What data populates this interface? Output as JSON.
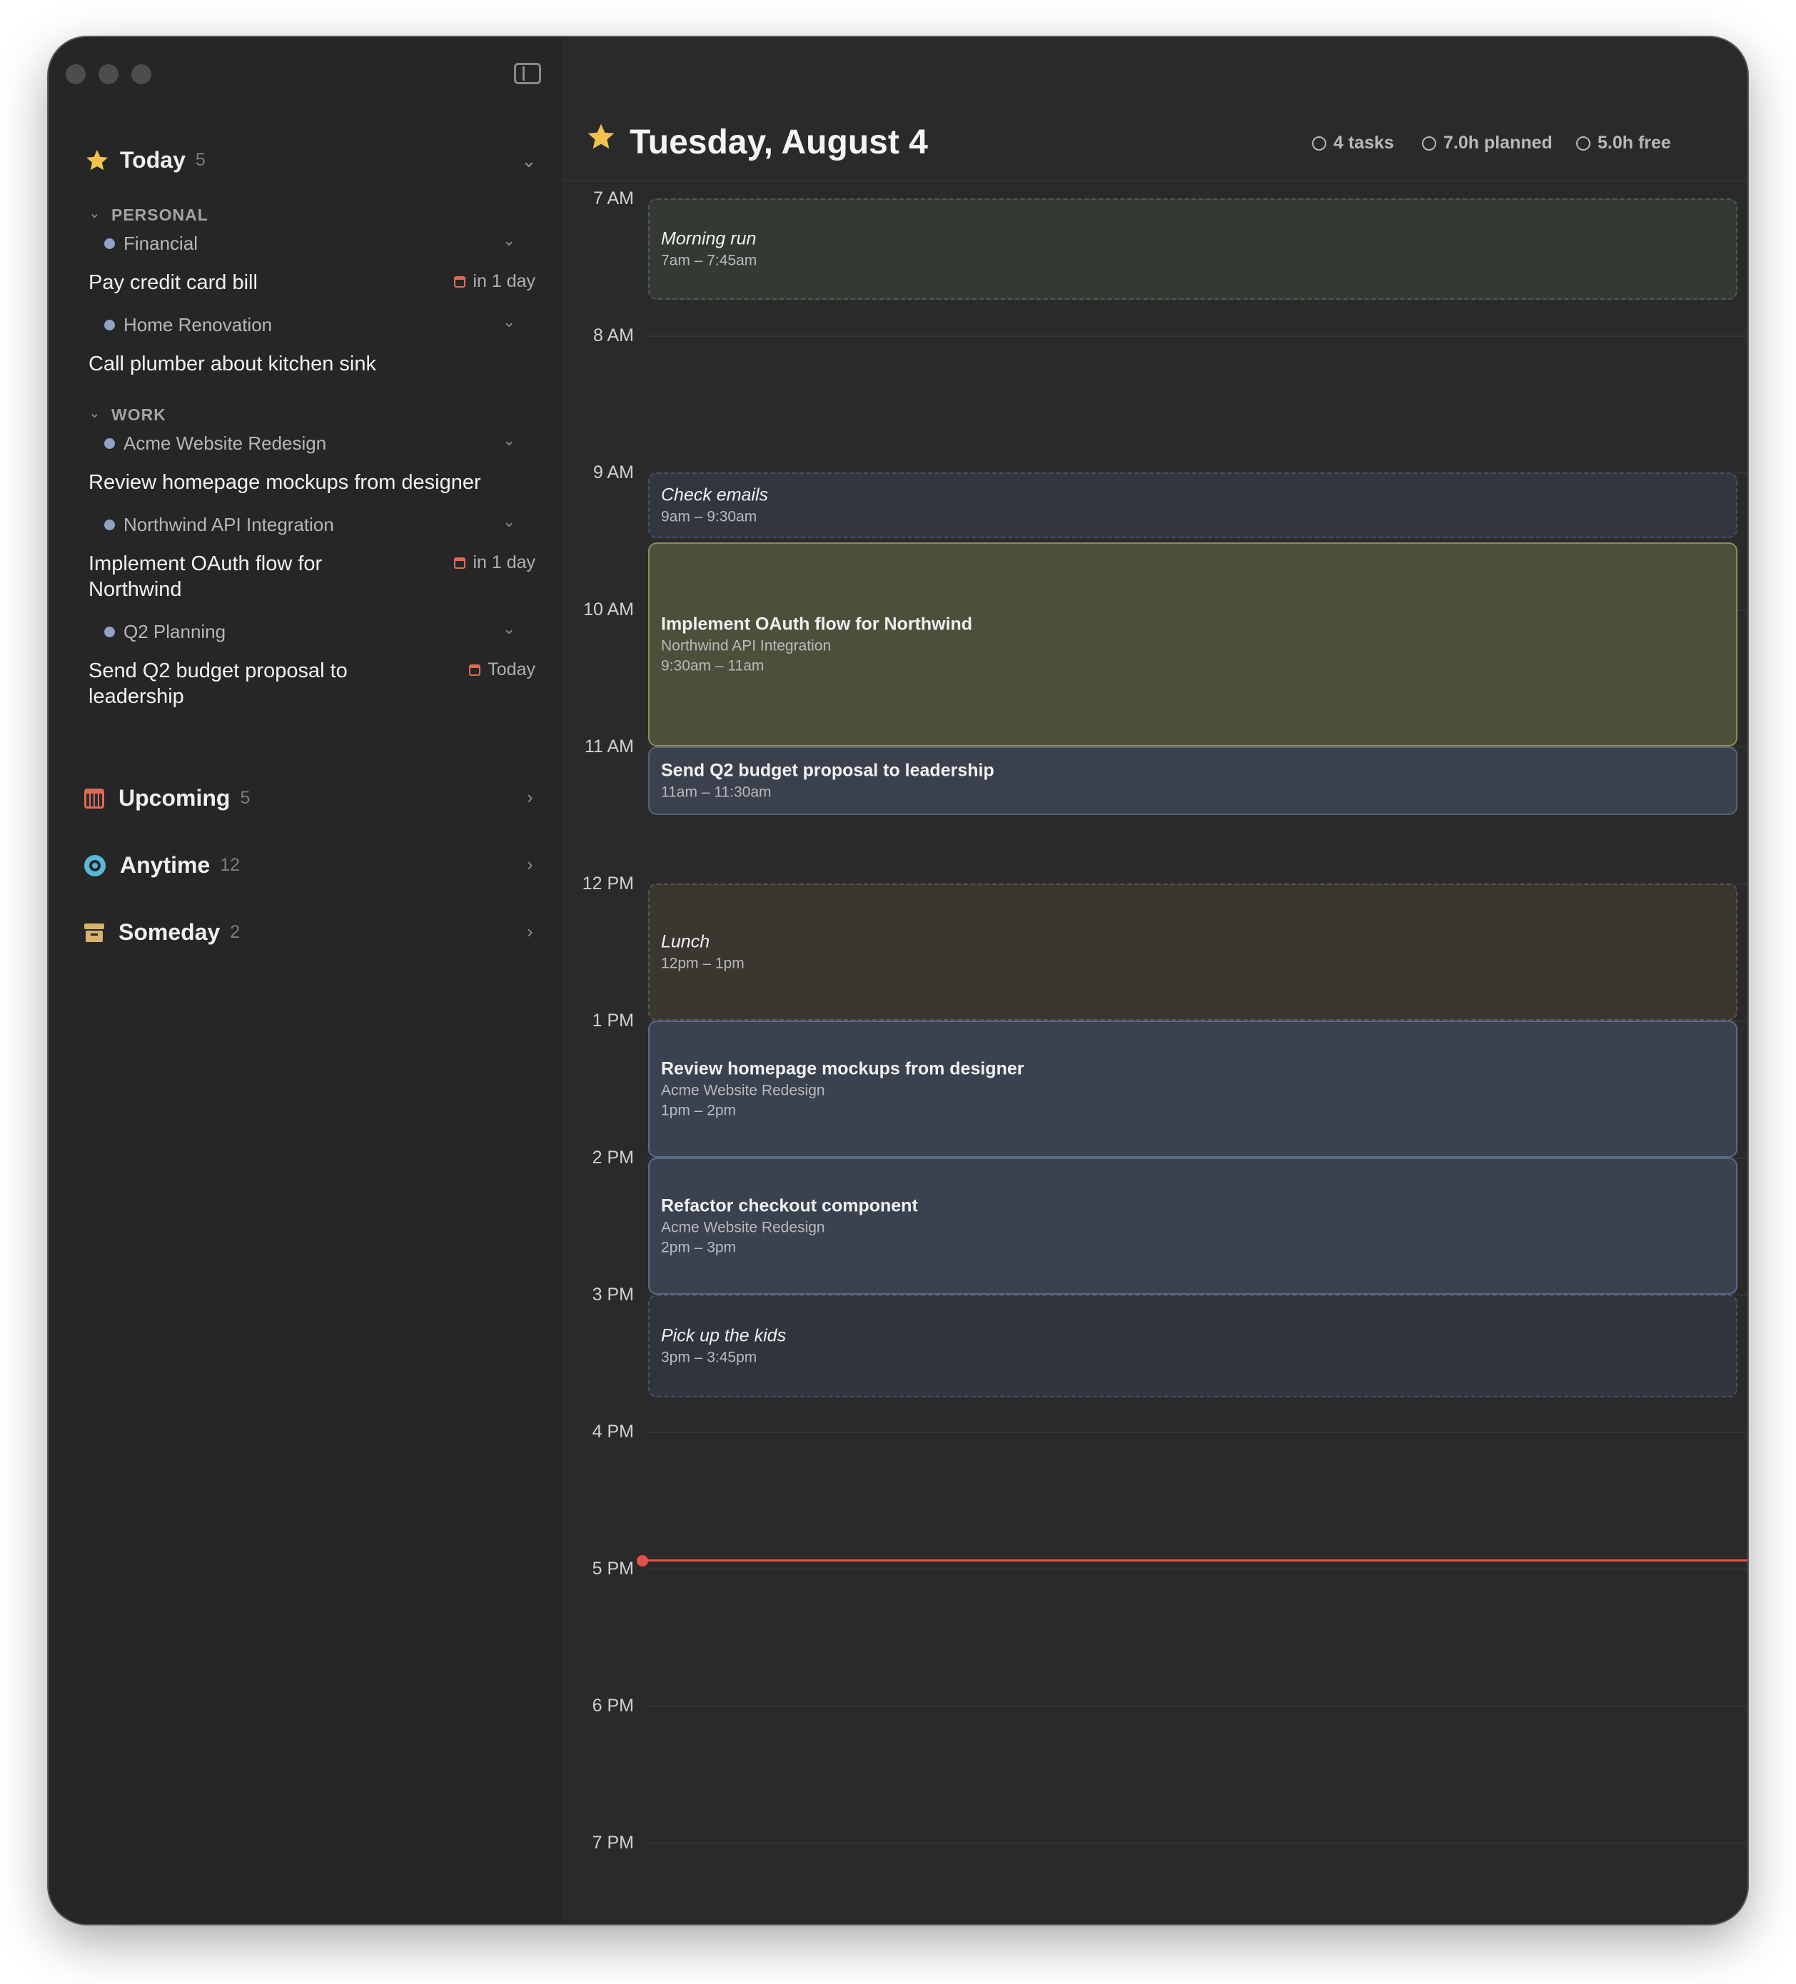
{
  "sidebar": {
    "today": {
      "label": "Today",
      "count": "5"
    },
    "groups": [
      {
        "label": "PERSONAL"
      },
      {
        "label": "WORK"
      }
    ],
    "projects": [
      {
        "label": "Financial"
      },
      {
        "label": "Home Renovation"
      },
      {
        "label": "Acme Website Redesign"
      },
      {
        "label": "Northwind API Integration"
      },
      {
        "label": "Q2 Planning"
      }
    ],
    "tasks": [
      {
        "label": "Pay credit card bill",
        "due": "in 1 day"
      },
      {
        "label": "Call plumber about kitchen sink",
        "due": ""
      },
      {
        "label": "Review homepage mockups from designer",
        "due": ""
      },
      {
        "label": "Implement OAuth flow for Northwind",
        "due": "in 1 day"
      },
      {
        "label": "Send Q2 budget proposal to leadership",
        "due": "Today"
      }
    ],
    "sections": [
      {
        "label": "Upcoming",
        "count": "5",
        "icon": "calendar-icon"
      },
      {
        "label": "Anytime",
        "count": "12",
        "icon": "circle-target-icon"
      },
      {
        "label": "Someday",
        "count": "2",
        "icon": "archive-box-icon"
      }
    ]
  },
  "header": {
    "title": "Tuesday, August 4",
    "tasks": "4 tasks",
    "planned": "7.0h planned",
    "free": "5.0h free"
  },
  "calendar": {
    "hours": [
      "7 AM",
      "8 AM",
      "9 AM",
      "10 AM",
      "11 AM",
      "12 PM",
      "1 PM",
      "2 PM",
      "3 PM",
      "4 PM",
      "5 PM",
      "6 PM",
      "7 PM"
    ],
    "events": [
      {
        "title": "Morning run",
        "subtitle": "",
        "time": "7am – 7:45am"
      },
      {
        "title": "Check emails",
        "subtitle": "",
        "time": "9am – 9:30am"
      },
      {
        "title": "Implement OAuth flow for Northwind",
        "subtitle": "Northwind API Integration",
        "time": "9:30am – 11am"
      },
      {
        "title": "Send Q2 budget proposal to leadership",
        "subtitle": "",
        "time": "11am – 11:30am"
      },
      {
        "title": "Lunch",
        "subtitle": "",
        "time": "12pm – 1pm"
      },
      {
        "title": "Review homepage mockups from designer",
        "subtitle": "Acme Website Redesign",
        "time": "1pm – 2pm"
      },
      {
        "title": "Refactor checkout component",
        "subtitle": "Acme Website Redesign",
        "time": "2pm – 3pm"
      },
      {
        "title": "Pick up the kids",
        "subtitle": "",
        "time": "3pm – 3:45pm"
      }
    ]
  },
  "colors": {
    "accent_star": "#f2c14e",
    "now_line": "#e0524a",
    "calendar_icon": "#e26a55",
    "anytime_icon": "#5bb8d4",
    "someday_icon": "#d9b26a"
  }
}
